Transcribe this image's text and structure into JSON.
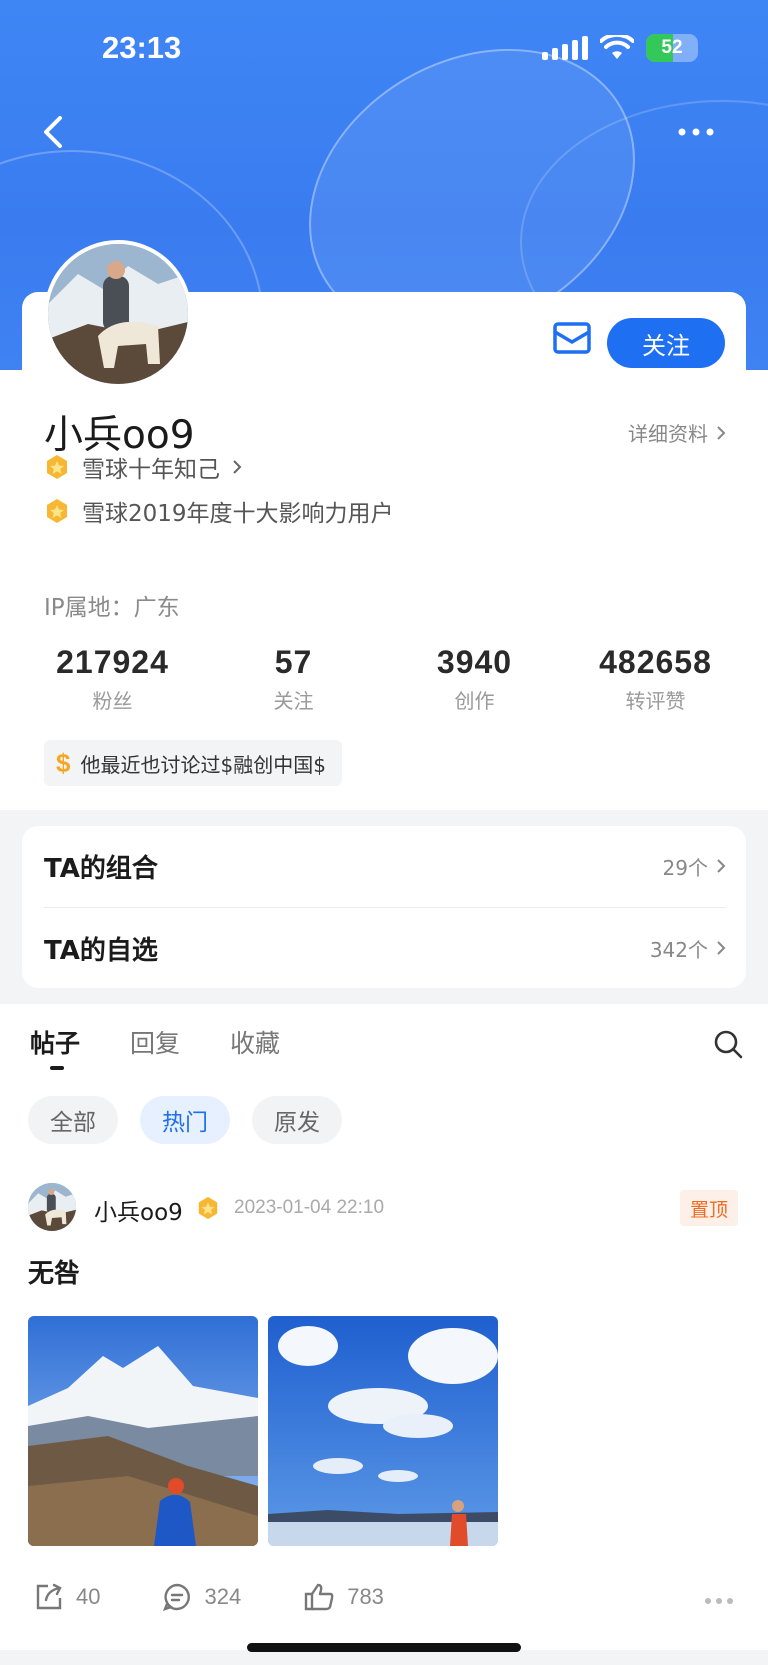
{
  "status_bar": {
    "time": "23:13",
    "battery": "52"
  },
  "header": {
    "back_label": "back",
    "more_label": "more"
  },
  "profile": {
    "name": "小兵oo9",
    "follow_label": "关注",
    "detail_link": "详细资料",
    "badges": [
      {
        "text": "雪球十年知己",
        "has_chevron": true
      },
      {
        "text": "雪球2019年度十大影响力用户",
        "has_chevron": false
      }
    ],
    "ip": "IP属地：广东",
    "stats": [
      {
        "value": "217924",
        "label": "粉丝"
      },
      {
        "value": "57",
        "label": "关注"
      },
      {
        "value": "3940",
        "label": "创作"
      },
      {
        "value": "482658",
        "label": "转评赞"
      }
    ],
    "mention": "他最近也讨论过$融创中国$"
  },
  "lists": [
    {
      "title": "TA的组合",
      "count": "29个"
    },
    {
      "title": "TA的自选",
      "count": "342个"
    }
  ],
  "tabs": [
    "帖子",
    "回复",
    "收藏"
  ],
  "filters": [
    "全部",
    "热门",
    "原发"
  ],
  "post": {
    "user": "小兵oo9",
    "time": "2023-01-04 22:10",
    "pinned": "置顶",
    "text": "无咎",
    "shares": "40",
    "comments": "324",
    "likes": "783"
  },
  "colors": {
    "accent": "#1f6ff2",
    "hero": "#3f86f5",
    "pinned": "#f26a21"
  }
}
